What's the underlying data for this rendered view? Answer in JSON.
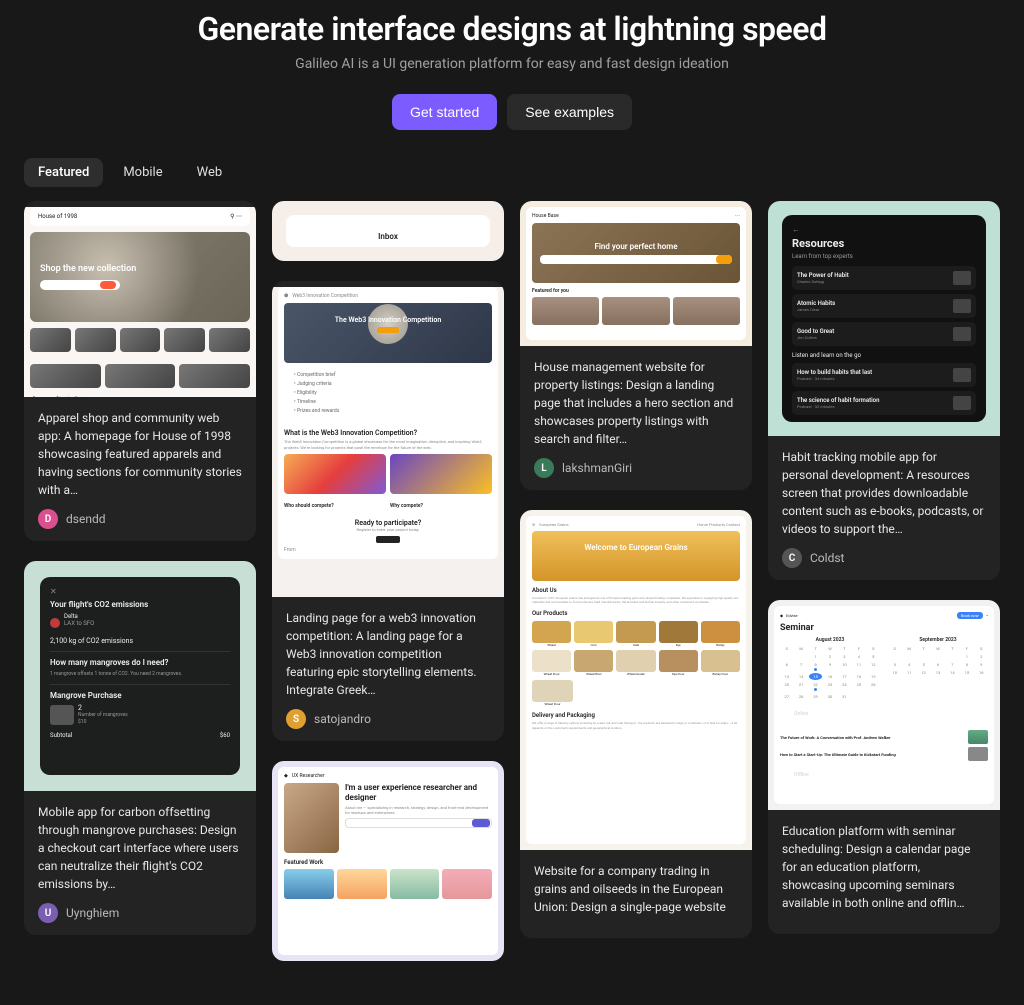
{
  "hero": {
    "title": "Generate interface designs at lightning speed",
    "subtitle": "Galileo AI is a UI generation platform for easy and fast design ideation",
    "primary_cta": "Get started",
    "secondary_cta": "See examples"
  },
  "tabs": {
    "featured": "Featured",
    "mobile": "Mobile",
    "web": "Web"
  },
  "cards": {
    "apparel": {
      "desc": "Apparel shop and community web app: A homepage for House of 1998 showcasing featured apparels and having sections for community stories with a…",
      "user": "dsendd",
      "avatar_bg": "#d94f8f",
      "avatar_initial": "D",
      "preview": {
        "brand": "House of 1998",
        "hero_text": "Shop the new collection",
        "section": "Community stories"
      }
    },
    "co2": {
      "desc": "Mobile app for carbon offsetting through mangrove purchases: Design a checkout cart interface where users can neutralize their flight's CO2 emissions by…",
      "user": "Uynghiem",
      "avatar_bg": "#7a5fb0",
      "avatar_initial": "U",
      "preview": {
        "title": "Your flight's CO2 emissions",
        "airline": "Delta",
        "route": "LAX to SFO",
        "amount": "2,100 kg of CO2 emissions",
        "q": "How many mangroves do I need?",
        "a": "1 mangrove offsets 1 tonne of CO2. You need 2 mangroves.",
        "purchase": "Mangrove Purchase",
        "qty_label": "Number of mangroves",
        "qty": "2",
        "price": "$10",
        "subtotal_label": "Subtotal",
        "subtotal": "$60"
      }
    },
    "inbox": {
      "preview": {
        "label": "Inbox"
      }
    },
    "web3": {
      "desc": "Landing page for a web3 innovation competition: A landing page for a Web3 innovation competition featuring epic storytelling elements. Integrate Greek…",
      "user": "satojandro",
      "avatar_bg": "#e0a030",
      "avatar_initial": "S",
      "preview": {
        "brand": "Web3 Innovation Competition",
        "hero": "The Web3 Innovation Competition",
        "section": "What is the Web3 Innovation Competition?",
        "ready": "Ready to participate?",
        "from": "From"
      }
    },
    "ux": {
      "preview": {
        "brand": "UX Researcher",
        "headline": "I'm a user experience researcher and designer",
        "section": "Featured Work"
      }
    },
    "house": {
      "desc": "House management website for property listings: Design a landing page that includes a hero section and showcases property listings with search and filter…",
      "user": "lakshmanGiri",
      "avatar_bg": "#3a7a5a",
      "avatar_initial": "L",
      "preview": {
        "brand": "House Base",
        "hero": "Find your perfect home",
        "section": "Featured for you"
      }
    },
    "grains": {
      "desc": "Website for a company trading in grains and oilseeds in the European Union: Design a single-page website",
      "preview": {
        "brand": "European Grains",
        "hero": "Welcome to European Grains",
        "about": "About Us",
        "products": "Our Products",
        "product_names": [
          "Wheat",
          "Corn",
          "Oats",
          "Rye",
          "Barley",
          "Wheat Flour",
          "Wheat Bran",
          "Wheat Gluten",
          "Rye Flour",
          "Barley Flour",
          "Wheat Flour"
        ],
        "delivery": "Delivery and Packaging"
      }
    },
    "resources": {
      "desc": "Habit tracking mobile app for personal development: A resources screen that provides downloadable content such as e-books, podcasts, or videos to support the…",
      "user": "Coldst",
      "avatar_bg": "#555",
      "avatar_initial": "C",
      "preview": {
        "title": "Resources",
        "subtitle": "Learn from top experts",
        "items": [
          {
            "title": "The Power of Habit",
            "author": "Charles Duhigg"
          },
          {
            "title": "Atomic Habits",
            "author": "James Clear"
          },
          {
            "title": "Good to Great",
            "author": "Jim Collins"
          }
        ],
        "section2": "Listen and learn on the go",
        "items2": [
          {
            "title": "How to build habits that last",
            "meta": "Podcast · 34 minutes"
          },
          {
            "title": "The science of habit formation",
            "meta": "Podcast · 32 minutes"
          }
        ]
      }
    },
    "seminar": {
      "desc": "Education platform with seminar scheduling: Design a calendar page for an education platform, showcasing upcoming seminars available in both online and offlin…",
      "preview": {
        "brand": "Edvise",
        "title": "Seminar",
        "month1": "August 2023",
        "month2": "September 2023",
        "tab_online": "Online",
        "tab_offline": "Offline"
      }
    }
  }
}
